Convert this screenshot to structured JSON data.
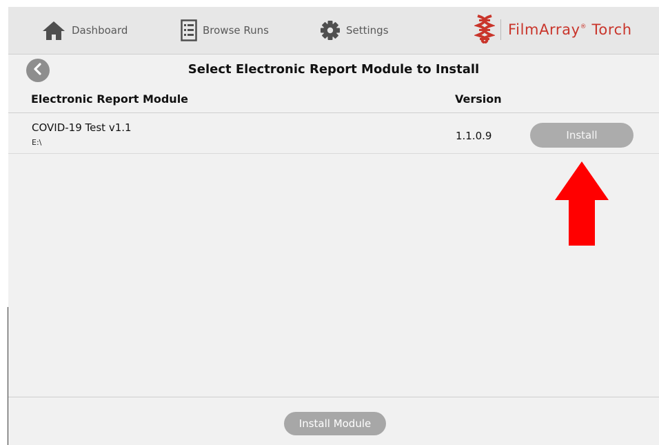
{
  "nav": {
    "dashboard": {
      "label": "Dashboard",
      "icon": "home-icon"
    },
    "browse_runs": {
      "label": "Browse Runs",
      "icon": "list-icon"
    },
    "settings": {
      "label": "Settings",
      "icon": "gear-icon"
    }
  },
  "brand": {
    "name": "FilmArray",
    "suffix": "Torch",
    "mark": "®",
    "color": "#c9352b"
  },
  "page": {
    "title": "Select Electronic Report Module to Install"
  },
  "table": {
    "headers": {
      "module": "Electronic Report Module",
      "version": "Version"
    },
    "rows": [
      {
        "name": "COVID-19 Test v1.1",
        "path": "E:\\",
        "version": "1.1.0.9",
        "action": "Install"
      }
    ]
  },
  "footer": {
    "install_module_label": "Install Module"
  },
  "annotation": {
    "arrow_color": "#ff0000"
  }
}
